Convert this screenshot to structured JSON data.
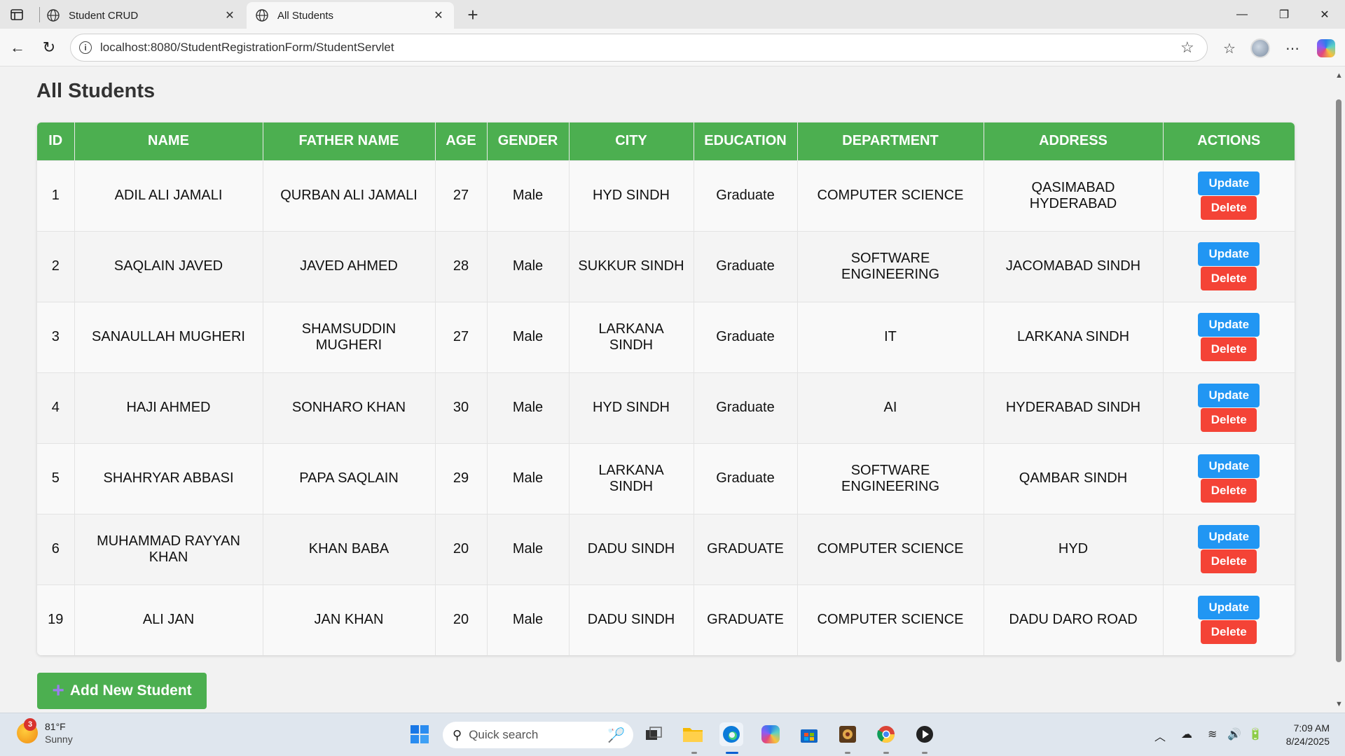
{
  "browser": {
    "tabs": [
      {
        "title": "Student CRUD",
        "active": false
      },
      {
        "title": "All Students",
        "active": true
      }
    ],
    "url": "localhost:8080/StudentRegistrationForm/StudentServlet"
  },
  "page": {
    "title": "All Students",
    "columns": [
      "ID",
      "NAME",
      "FATHER NAME",
      "AGE",
      "GENDER",
      "CITY",
      "EDUCATION",
      "DEPARTMENT",
      "ADDRESS",
      "ACTIONS"
    ],
    "rows": [
      {
        "id": "1",
        "name": "ADIL ALI JAMALI",
        "father": "QURBAN ALI JAMALI",
        "age": "27",
        "gender": "Male",
        "city": "HYD SINDH",
        "education": "Graduate",
        "department": "COMPUTER SCIENCE",
        "address": "QASIMABAD HYDERABAD"
      },
      {
        "id": "2",
        "name": "SAQLAIN JAVED",
        "father": "JAVED AHMED",
        "age": "28",
        "gender": "Male",
        "city": "SUKKUR SINDH",
        "education": "Graduate",
        "department": "SOFTWARE ENGINEERING",
        "address": "JACOMABAD SINDH"
      },
      {
        "id": "3",
        "name": "SANAULLAH MUGHERI",
        "father": "SHAMSUDDIN MUGHERI",
        "age": "27",
        "gender": "Male",
        "city": "LARKANA SINDH",
        "education": "Graduate",
        "department": "IT",
        "address": "LARKANA SINDH"
      },
      {
        "id": "4",
        "name": "HAJI AHMED",
        "father": "SONHARO KHAN",
        "age": "30",
        "gender": "Male",
        "city": "HYD SINDH",
        "education": "Graduate",
        "department": "AI",
        "address": "HYDERABAD SINDH"
      },
      {
        "id": "5",
        "name": "SHAHRYAR ABBASI",
        "father": "PAPA SAQLAIN",
        "age": "29",
        "gender": "Male",
        "city": "LARKANA SINDH",
        "education": "Graduate",
        "department": "SOFTWARE ENGINEERING",
        "address": "QAMBAR SINDH"
      },
      {
        "id": "6",
        "name": "MUHAMMAD RAYYAN KHAN",
        "father": "KHAN BABA",
        "age": "20",
        "gender": "Male",
        "city": "DADU SINDH",
        "education": "GRADUATE",
        "department": "COMPUTER SCIENCE",
        "address": "HYD"
      },
      {
        "id": "19",
        "name": "ALI JAN",
        "father": "JAN KHAN",
        "age": "20",
        "gender": "Male",
        "city": "DADU SINDH",
        "education": "GRADUATE",
        "department": "COMPUTER SCIENCE",
        "address": "DADU DARO ROAD"
      }
    ],
    "actions": {
      "update_label": "Update",
      "delete_label": "Delete"
    },
    "add_button_label": "Add New Student"
  },
  "colors": {
    "header_green": "#4caf50",
    "update_blue": "#2196f3",
    "delete_red": "#f44336"
  },
  "taskbar": {
    "weather": {
      "temp": "81°F",
      "condition": "Sunny",
      "badge": "3"
    },
    "search_placeholder": "Quick search",
    "time": "7:09 AM",
    "date": "8/24/2025"
  }
}
